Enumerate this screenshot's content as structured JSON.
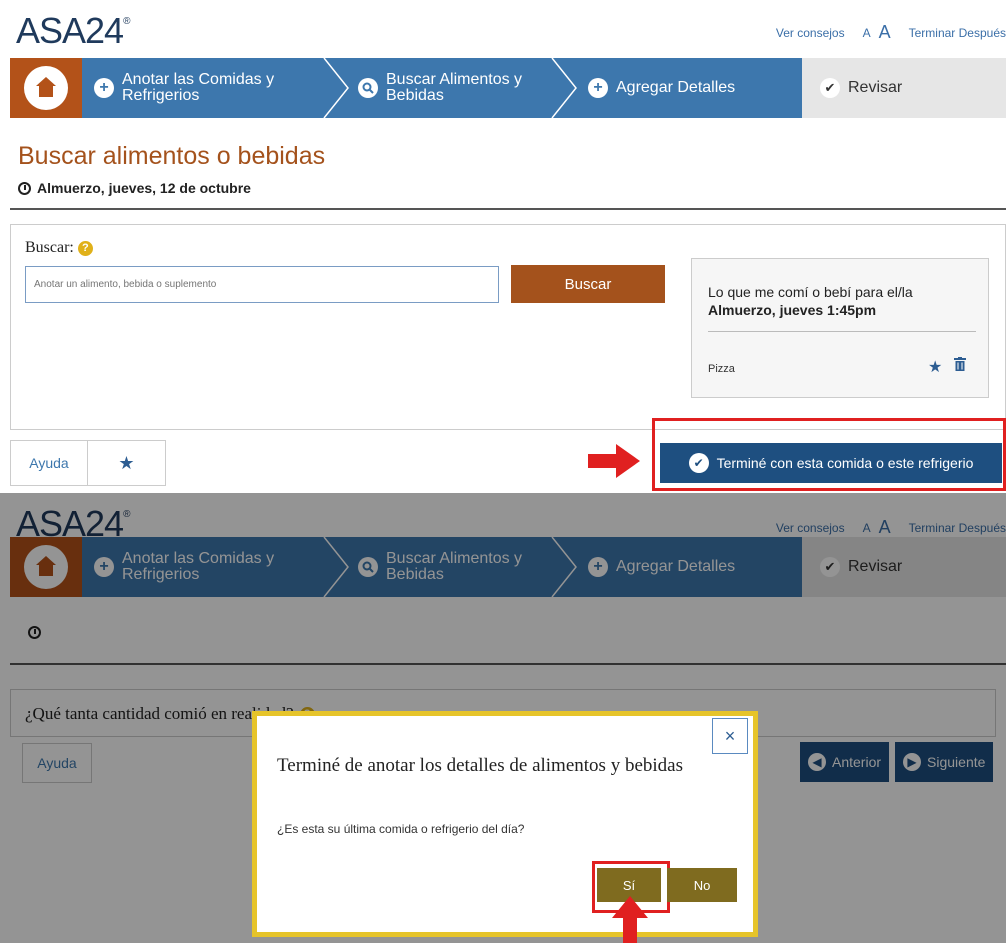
{
  "brand": {
    "logo": "ASA24",
    "mark": "®"
  },
  "header_links": {
    "tips": "Ver consejos",
    "font_small": "A",
    "font_large": "A",
    "finish_later": "Terminar Después"
  },
  "steps": [
    {
      "label_1": "Anotar las Comidas y",
      "label_2": "Refrigerios",
      "icon": "plus-circle-icon"
    },
    {
      "label_1": "Buscar Alimentos y",
      "label_2": "Bebidas",
      "icon": "search-circle-icon"
    },
    {
      "label_1": "Agregar Detalles",
      "label_2": "",
      "icon": "plus-circle-icon"
    },
    {
      "label_1": "Revisar",
      "label_2": "",
      "icon": "check-circle-icon"
    }
  ],
  "search_screen": {
    "title": "Buscar alimentos o bebidas",
    "meal_line": "Almuerzo, jueves, 12 de octubre",
    "search_label": "Buscar:",
    "search_placeholder": "Anotar un alimento, bebida o suplemento",
    "search_button": "Buscar",
    "ate_title_1": "Lo que me comí o bebí para el/la",
    "ate_title_2": "Almuerzo, jueves 1:45pm",
    "ate_items": [
      "Pizza"
    ],
    "help_button": "Ayuda",
    "done_button": "Terminé con esta comida o este refrigerio"
  },
  "detail_screen": {
    "question": "¿Qué tanta cantidad comió en realidad?",
    "help_button": "Ayuda",
    "prev_button": "Anterior",
    "next_button": "Siguiente"
  },
  "modal": {
    "close": "×",
    "title": "Terminé de anotar los detalles de alimentos y bebidas",
    "question": "¿Es esta su última comida o refrigerio del día?",
    "yes": "Sí",
    "no": "No"
  },
  "colors": {
    "brand_brown": "#a4521c",
    "nav_blue": "#3d77ad",
    "dark_blue": "#1e4f80",
    "modal_border": "#e6c42a",
    "highlight_red": "#e02020"
  }
}
